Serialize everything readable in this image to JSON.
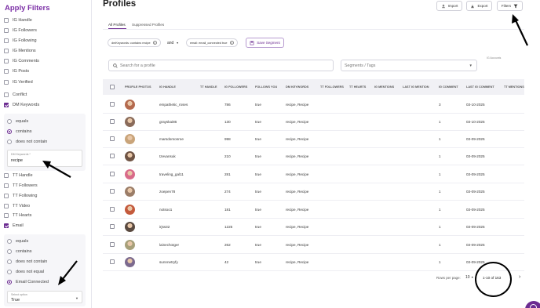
{
  "sidebar": {
    "title": "Apply Filters",
    "items_top": [
      {
        "label": "IG Handle",
        "checked": false
      },
      {
        "label": "IG Followers",
        "checked": false
      },
      {
        "label": "IG Following",
        "checked": false
      },
      {
        "label": "IG Mentions",
        "checked": false
      },
      {
        "label": "IG Comments",
        "checked": false
      },
      {
        "label": "IG Posts",
        "checked": false
      },
      {
        "label": "IG Verified",
        "checked": false
      },
      {
        "label": "Conflict",
        "checked": false
      },
      {
        "label": "DM Keywords",
        "checked": true
      }
    ],
    "dm_panel": {
      "options": [
        {
          "label": "equals",
          "selected": false
        },
        {
          "label": "contains",
          "selected": true
        },
        {
          "label": "does not contain",
          "selected": false
        }
      ],
      "keyword_label": "DM Keywords *",
      "keyword_value": "recipe"
    },
    "items_mid": [
      {
        "label": "TT Handle",
        "checked": false
      },
      {
        "label": "TT Followers",
        "checked": false
      },
      {
        "label": "TT Following",
        "checked": false
      },
      {
        "label": "TT Video",
        "checked": false
      },
      {
        "label": "TT Hearts",
        "checked": false
      },
      {
        "label": "Email",
        "checked": true
      }
    ],
    "email_panel": {
      "options": [
        {
          "label": "equals",
          "selected": false
        },
        {
          "label": "contains",
          "selected": false
        },
        {
          "label": "does not contain",
          "selected": false
        },
        {
          "label": "does not equal",
          "selected": false
        },
        {
          "label": "Email Connected",
          "selected": true
        }
      ],
      "select_label": "Select option",
      "select_value": "True"
    }
  },
  "header": {
    "title": "Profiles",
    "import_label": "Import",
    "export_label": "Export",
    "filters_label": "Filters"
  },
  "tabs": [
    {
      "label": "All Profiles",
      "active": true
    },
    {
      "label": "Suppressed Profiles",
      "active": false
    }
  ],
  "filter_chips": [
    {
      "label": "dmKeywords: contains recipe"
    },
    {
      "label": "email: email_connected true"
    }
  ],
  "logic_operator": "and",
  "save_segment_label": "Save Segment",
  "search": {
    "placeholder": "Search for a profile"
  },
  "segments": {
    "placeholder": "Segments / Tags"
  },
  "ig_accounts_label": "IG Accounts",
  "table": {
    "columns": [
      "PROFILE PHOTOS",
      "IG HANDLE",
      "TT HANDLE",
      "IG FOLLOWERS",
      "FOLLOWS YOU",
      "DM KEYWORDS",
      "TT FOLLOWERS",
      "TT HEARTS",
      "IG MENTIONS",
      "LAST IG MENTION",
      "IG COMMENT",
      "LAST IG COMMENT",
      "TT MENTIONS"
    ],
    "rows": [
      {
        "handle": "empathetic_roses",
        "followers": "786",
        "follows": "true",
        "keywords": "recipe, Recipe",
        "ig_comment": "3",
        "last_comment": "03-10-2025",
        "avatar_color": "#b46a4e"
      },
      {
        "handle": "grayskai86",
        "followers": "130",
        "follows": "true",
        "keywords": "recipe, Recipe",
        "ig_comment": "1",
        "last_comment": "03-10-2025",
        "avatar_color": "#8a6b5a"
      },
      {
        "handle": "marsdomonroe",
        "followers": "998",
        "follows": "true",
        "keywords": "recipe, Recipe",
        "ig_comment": "1",
        "last_comment": "03-09-2025",
        "avatar_color": "#c9a47a"
      },
      {
        "handle": "tzevansuk",
        "followers": "210",
        "follows": "true",
        "keywords": "recipe, Recipe",
        "ig_comment": "1",
        "last_comment": "03-09-2025",
        "avatar_color": "#6f5444"
      },
      {
        "handle": "traveling_gal11",
        "followers": "281",
        "follows": "true",
        "keywords": "recipe, Recipe",
        "ig_comment": "1",
        "last_comment": "03-09-2025",
        "avatar_color": "#d96b8a"
      },
      {
        "handle": "zoepen78",
        "followers": "274",
        "follows": "true",
        "keywords": "recipe, Recipe",
        "ig_comment": "1",
        "last_comment": "03-09-2025",
        "avatar_color": "#9b7d68"
      },
      {
        "handle": "notsoo1",
        "followers": "181",
        "follows": "true",
        "keywords": "recipe, Recipe",
        "ig_comment": "1",
        "last_comment": "03-09-2025",
        "avatar_color": "#c45a3c"
      },
      {
        "handle": "irjss32",
        "followers": "1225",
        "follows": "true",
        "keywords": "recipe, Recipe",
        "ig_comment": "1",
        "last_comment": "03-09-2025",
        "avatar_color": "#5a4a40"
      },
      {
        "handle": "lainechotger",
        "followers": "262",
        "follows": "true",
        "keywords": "recipe, Recipe",
        "ig_comment": "1",
        "last_comment": "03-09-2025",
        "avatar_color": "#a7a07a"
      },
      {
        "handle": "sunnnetryfy",
        "followers": "42",
        "follows": "true",
        "keywords": "recipe, Recipe",
        "ig_comment": "1",
        "last_comment": "03-09-2025",
        "avatar_color": "#7c6a8e"
      }
    ]
  },
  "pagination": {
    "rows_per_page_label": "Rows per page:",
    "rows_per_page": "10",
    "range": "1-10 of 163"
  },
  "colors": {
    "accent": "#6c2c91",
    "header_bg": "#f1f1f5"
  }
}
